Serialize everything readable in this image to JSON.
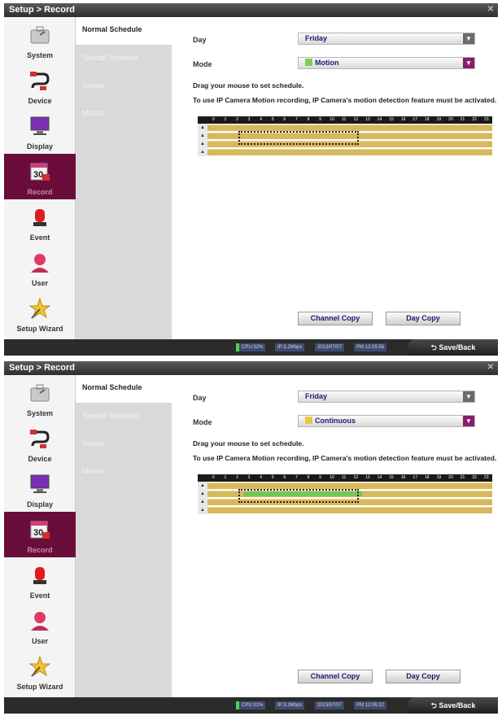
{
  "panels": [
    {
      "title": "Setup > Record",
      "sidebar": [
        {
          "label": "System",
          "icon": "system-icon"
        },
        {
          "label": "Device",
          "icon": "device-icon"
        },
        {
          "label": "Display",
          "icon": "display-icon"
        },
        {
          "label": "Record",
          "icon": "record-calendar-icon"
        },
        {
          "label": "Event",
          "icon": "event-alarm-icon"
        },
        {
          "label": "User",
          "icon": "user-icon"
        },
        {
          "label": "Setup Wizard",
          "icon": "wizard-star-icon"
        }
      ],
      "submenu": [
        "Normal Schedule",
        "Special Schedule",
        "Sensor",
        "Motion"
      ],
      "day_label": "Day",
      "day_value": "Friday",
      "mode_label": "Mode",
      "mode_value": "Motion",
      "mode_chip_color": "#7ed14f",
      "hint1": "Drag your mouse to set schedule.",
      "hint2": "To use IP Camera Motion recording, IP Camera's motion detection feature must be activated.",
      "hours": [
        "0",
        "1",
        "2",
        "3",
        "4",
        "5",
        "6",
        "7",
        "8",
        "9",
        "10",
        "11",
        "12",
        "13",
        "14",
        "15",
        "16",
        "17",
        "18",
        "19",
        "20",
        "21",
        "22",
        "23"
      ],
      "channels": [
        "1",
        "2",
        "3",
        "4"
      ],
      "green_hours": [],
      "buttons": {
        "channel_copy": "Channel Copy",
        "day_copy": "Day Copy"
      },
      "status": {
        "cpu": "CPU:32%",
        "ip": "IP:3.2Mbps",
        "date": "2013/07/07",
        "time": "PM 12:05:56",
        "save": "Save/Back"
      }
    },
    {
      "title": "Setup > Record",
      "sidebar": [
        {
          "label": "System",
          "icon": "system-icon"
        },
        {
          "label": "Device",
          "icon": "device-icon"
        },
        {
          "label": "Display",
          "icon": "display-icon"
        },
        {
          "label": "Record",
          "icon": "record-calendar-icon"
        },
        {
          "label": "Event",
          "icon": "event-alarm-icon"
        },
        {
          "label": "User",
          "icon": "user-icon"
        },
        {
          "label": "Setup Wizard",
          "icon": "wizard-star-icon"
        }
      ],
      "submenu": [
        "Normal Schedule",
        "Special Schedule",
        "Sensor",
        "Motion"
      ],
      "day_label": "Day",
      "day_value": "Friday",
      "mode_label": "Mode",
      "mode_value": "Continuous",
      "mode_chip_color": "#e8c640",
      "hint1": "Drag your mouse to set schedule.",
      "hint2": "To use IP Camera Motion recording, IP Camera's motion detection feature must be activated.",
      "hours": [
        "0",
        "1",
        "2",
        "3",
        "4",
        "5",
        "6",
        "7",
        "8",
        "9",
        "10",
        "11",
        "12",
        "13",
        "14",
        "15",
        "16",
        "17",
        "18",
        "19",
        "20",
        "21",
        "22",
        "23"
      ],
      "channels": [
        "1",
        "2",
        "3",
        "4"
      ],
      "green_hours": [
        3,
        13
      ],
      "buttons": {
        "channel_copy": "Channel Copy",
        "day_copy": "Day Copy"
      },
      "status": {
        "cpu": "CPU:21%",
        "ip": "IP:3.2Mbps",
        "date": "2013/07/07",
        "time": "PM 12:06:22",
        "save": "Save/Back"
      }
    }
  ],
  "colors": {
    "accent": "#6a0d3a",
    "schedule_bar": "#d8b85c",
    "motion_green": "#76c653",
    "button_text": "#1a1a6e"
  }
}
